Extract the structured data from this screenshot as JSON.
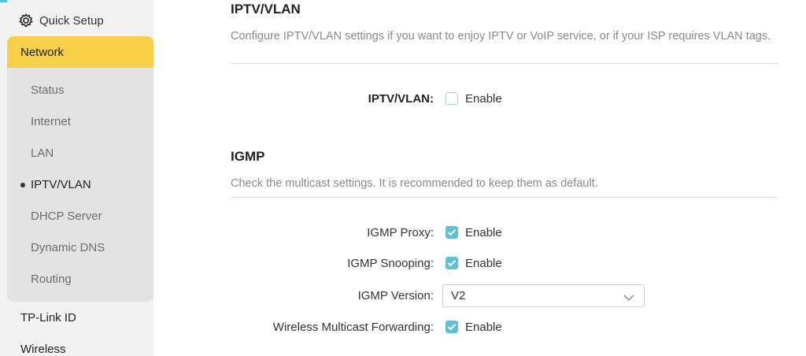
{
  "sidebar": {
    "quick_setup": "Quick Setup",
    "network": "Network",
    "sub_items": [
      {
        "label": "Status"
      },
      {
        "label": "Internet"
      },
      {
        "label": "LAN"
      },
      {
        "label": "IPTV/VLAN"
      },
      {
        "label": "DHCP Server"
      },
      {
        "label": "Dynamic DNS"
      },
      {
        "label": "Routing"
      }
    ],
    "current_sub_item": "IPTV/VLAN",
    "tplink_id": "TP-Link ID",
    "wireless": "Wireless"
  },
  "iptv": {
    "title": "IPTV/VLAN",
    "description": "Configure IPTV/VLAN settings if you want to enjoy IPTV or VoIP service, or if your ISP requires VLAN tags.",
    "field_label": "IPTV/VLAN:",
    "enable_label": "Enable",
    "enabled": false
  },
  "igmp": {
    "title": "IGMP",
    "description": "Check the multicast settings. It is recommended to keep them as default.",
    "proxy_label": "IGMP Proxy:",
    "proxy_enable": "Enable",
    "proxy_checked": true,
    "snooping_label": "IGMP Snooping:",
    "snooping_enable": "Enable",
    "snooping_checked": true,
    "version_label": "IGMP Version:",
    "version_value": "V2",
    "wmf_label": "Wireless Multicast Forwarding:",
    "wmf_enable": "Enable",
    "wmf_checked": true
  },
  "colors": {
    "active_nav": "#f7cf48",
    "checkbox_checked": "#5ec1d6",
    "sidebar_bg": "#f2f2f2",
    "subnav_bg": "#e3e3e3"
  }
}
